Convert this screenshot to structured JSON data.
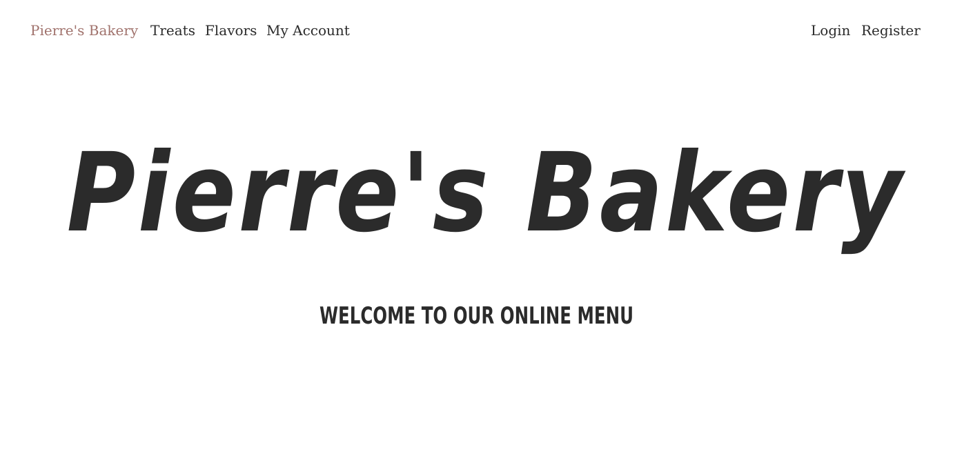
{
  "navbar": {
    "brand": "Pierre's Bakery",
    "links": [
      "Treats",
      "Flavors",
      "My Account"
    ],
    "auth_links": [
      "Login",
      "Register"
    ],
    "brand_color": "#a0726c",
    "text_color": "#2b2b2b"
  },
  "hero": {
    "title": "Pierre's Bakery",
    "subtitle": "WELCOME TO OUR ONLINE MENU"
  }
}
